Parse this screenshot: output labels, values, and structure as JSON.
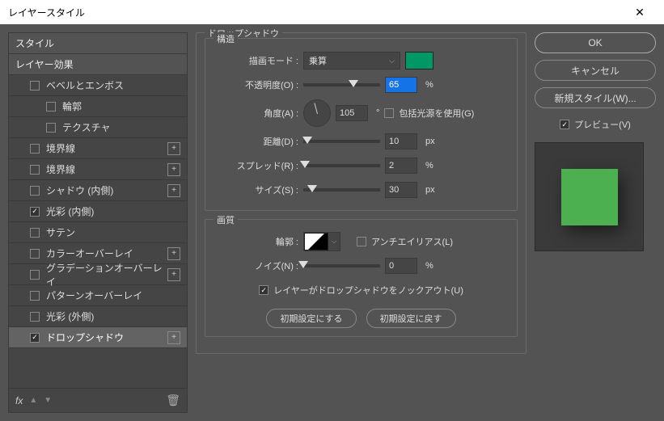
{
  "window": {
    "title": "レイヤースタイル"
  },
  "sidebar": {
    "style": "スタイル",
    "effects": "レイヤー効果",
    "items": [
      {
        "label": "ベベルとエンボス",
        "checked": false,
        "level": 1
      },
      {
        "label": "輪郭",
        "checked": false,
        "level": 2
      },
      {
        "label": "テクスチャ",
        "checked": false,
        "level": 2
      },
      {
        "label": "境界線",
        "checked": false,
        "level": 1,
        "plus": true
      },
      {
        "label": "境界線",
        "checked": false,
        "level": 1,
        "plus": true
      },
      {
        "label": "シャドウ (内側)",
        "checked": false,
        "level": 1,
        "plus": true
      },
      {
        "label": "光彩 (内側)",
        "checked": true,
        "level": 1
      },
      {
        "label": "サテン",
        "checked": false,
        "level": 1
      },
      {
        "label": "カラーオーバーレイ",
        "checked": false,
        "level": 1,
        "plus": true
      },
      {
        "label": "グラデーションオーバーレイ",
        "checked": false,
        "level": 1,
        "plus": true
      },
      {
        "label": "パターンオーバーレイ",
        "checked": false,
        "level": 1
      },
      {
        "label": "光彩 (外側)",
        "checked": false,
        "level": 1
      },
      {
        "label": "ドロップシャドウ",
        "checked": true,
        "level": 1,
        "plus": true,
        "selected": true
      }
    ],
    "fx": "fx"
  },
  "main": {
    "section_title": "ドロップシャドウ",
    "structure": "構造",
    "blend_mode_label": "描画モード :",
    "blend_mode_value": "乗算",
    "color": "#009966",
    "opacity_label": "不透明度(O) :",
    "opacity_value": "65",
    "opacity_unit": "%",
    "angle_label": "角度(A) :",
    "angle_value": "105",
    "angle_unit": "°",
    "global_light_label": "包括光源を使用(G)",
    "distance_label": "距離(D) :",
    "distance_value": "10",
    "distance_unit": "px",
    "spread_label": "スプレッド(R) :",
    "spread_value": "2",
    "spread_unit": "%",
    "size_label": "サイズ(S) :",
    "size_value": "30",
    "size_unit": "px",
    "quality": "画質",
    "contour_label": "輪郭 :",
    "antialias_label": "アンチエイリアス(L)",
    "noise_label": "ノイズ(N) :",
    "noise_value": "0",
    "noise_unit": "%",
    "knockout_label": "レイヤーがドロップシャドウをノックアウト(U)",
    "make_default": "初期設定にする",
    "reset_default": "初期設定に戻す"
  },
  "right": {
    "ok": "OK",
    "cancel": "キャンセル",
    "new_style": "新規スタイル(W)...",
    "preview": "プレビュー(V)",
    "preview_color": "#5bc75b"
  }
}
